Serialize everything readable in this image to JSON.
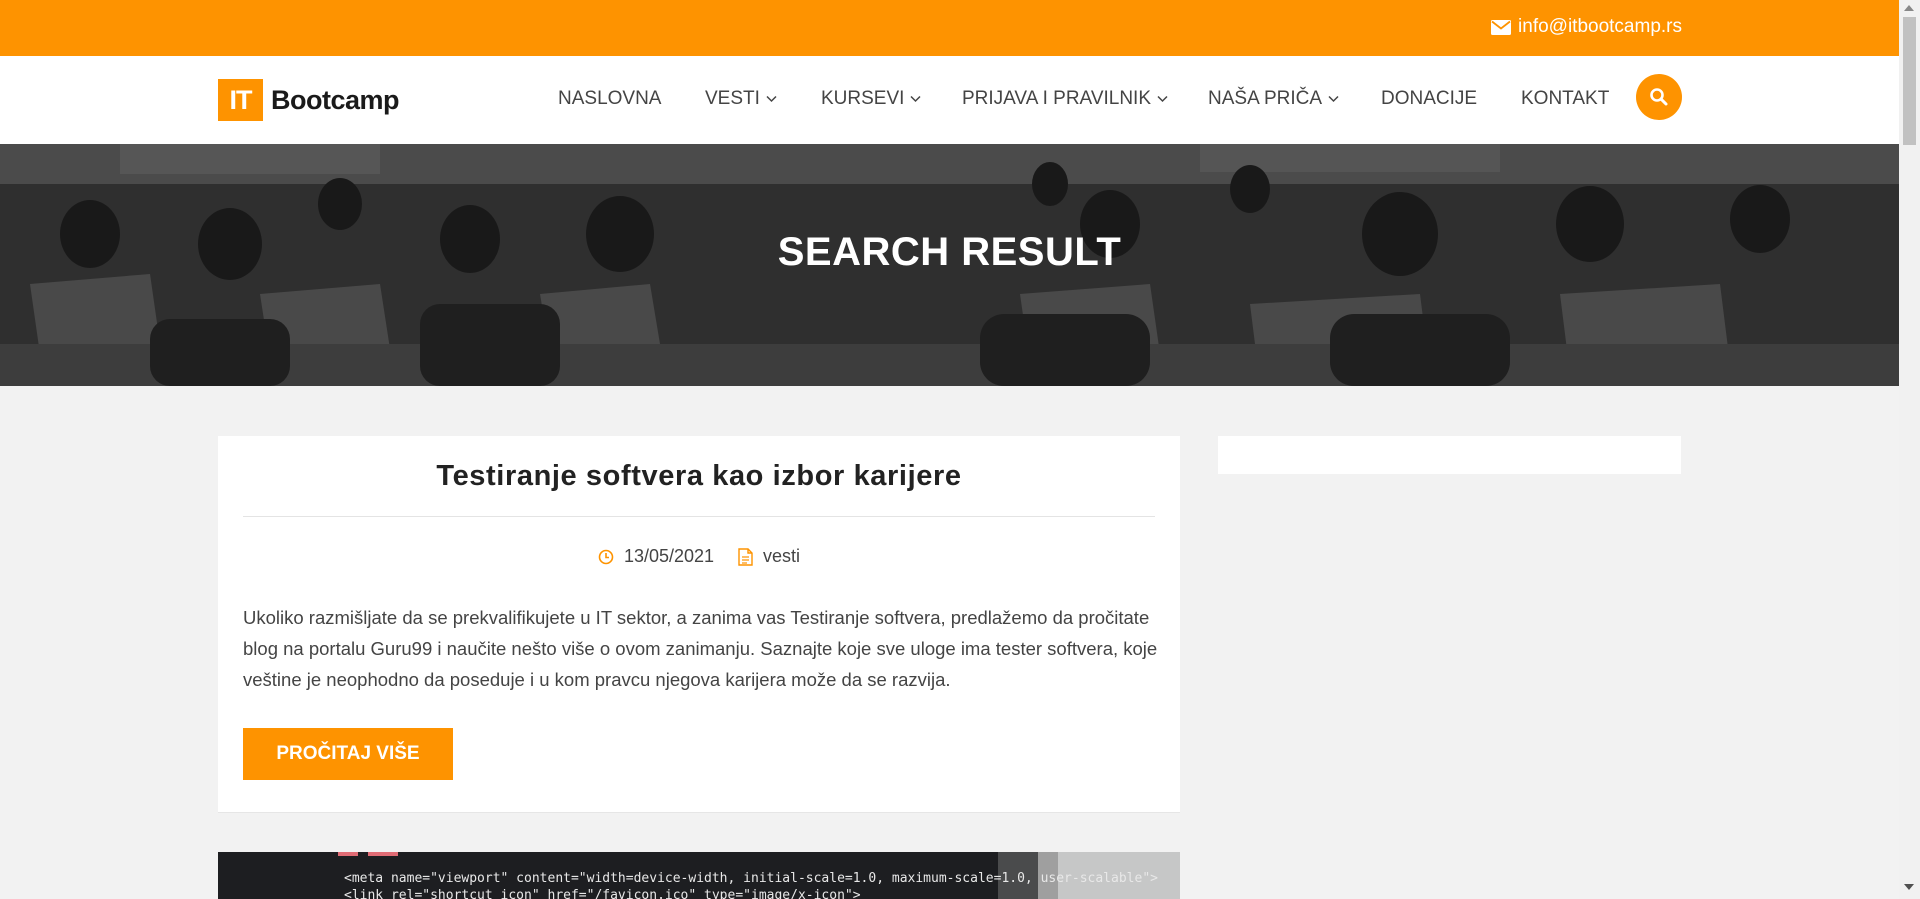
{
  "topbar": {
    "email": "info@itbootcamp.rs",
    "email_icon": "envelope-icon",
    "color": "#fe9300"
  },
  "header": {
    "logo": {
      "badge": "IT",
      "text": "Bootcamp"
    },
    "nav": [
      {
        "label": "NASLOVNA",
        "dropdown": false
      },
      {
        "label": "VESTI",
        "dropdown": true
      },
      {
        "label": "KURSEVI",
        "dropdown": true
      },
      {
        "label": "PRIJAVA I PRAVILNIK",
        "dropdown": true
      },
      {
        "label": "NAŠA PRIČA",
        "dropdown": true
      },
      {
        "label": "DONACIJE",
        "dropdown": false
      },
      {
        "label": "KONTAKT",
        "dropdown": false
      }
    ],
    "search_icon": "search-icon"
  },
  "hero": {
    "title": "SEARCH RESULT"
  },
  "post": {
    "title": "Testiranje softvera kao izbor karijere",
    "date": "13/05/2021",
    "category": "vesti",
    "excerpt": "Ukoliko razmišljate da se prekvalifikujete u IT sektor, a zanima vas Testiranje softvera, predlažemo da pročitate blog na portalu Guru99 i naučite nešto više o ovom zanimanju. Saznajte koje sve uloge ima tester softvera, koje veštine je neophodno da poseduje i u kom pravcu njegova karijera može da se razvija.",
    "read_more": "PROČITAJ VIŠE"
  },
  "code_preview": {
    "line1": "<meta name=\"viewport\" content=\"width=device-width, initial-scale=1.0, maximum-scale=1.0, user-scalable\">",
    "line2": "<link rel=\"shortcut icon\" href=\"/favicon.ico\" type=\"image/x-icon\">"
  }
}
